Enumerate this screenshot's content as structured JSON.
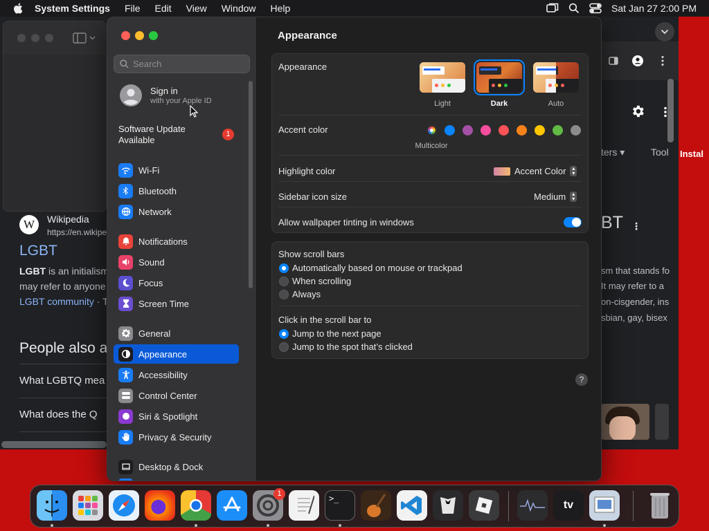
{
  "menubar": {
    "app_name": "System Settings",
    "menus": [
      "File",
      "Edit",
      "View",
      "Window",
      "Help"
    ],
    "clock": "Sat Jan 27  2:00 PM"
  },
  "background": {
    "wiki_name": "Wikipedia",
    "wiki_url": "https://en.wikipe",
    "heading": "LGBT",
    "snippet_bold": "LGBT",
    "snippet_rest": " is an initialism",
    "snippet_line2": "may refer to anyone",
    "snippet_link": "LGBT community",
    "snippet_link_tail": " · T",
    "people_also": "People also a",
    "q1": "What LGBTQ mea",
    "q2": "What does the Q",
    "right_filters": "ters",
    "right_tools": "Tool",
    "right_heading": "BT",
    "right_line1": "sm that stands fo",
    "right_line2": "It may refer to a",
    "right_line3": "on-cisgender, ins",
    "right_line4": "sbian, gay, bisex",
    "right_install": "Instal"
  },
  "sidebar": {
    "search_placeholder": "Search",
    "account_title": "Sign in",
    "account_subtitle": "with your Apple ID",
    "update_title": "Software Update",
    "update_title2": "Available",
    "update_badge": "1",
    "items": [
      {
        "label": "Wi-Fi",
        "icon": "wifi-icon",
        "color": "#1a7cf5"
      },
      {
        "label": "Bluetooth",
        "icon": "bluetooth-icon",
        "color": "#1a7cf5"
      },
      {
        "label": "Network",
        "icon": "globe-icon",
        "color": "#1a7cf5"
      },
      {
        "label": "Notifications",
        "icon": "bell-icon",
        "color": "#e8433a"
      },
      {
        "label": "Sound",
        "icon": "speaker-icon",
        "color": "#e8436a"
      },
      {
        "label": "Focus",
        "icon": "moon-icon",
        "color": "#5b4fd0"
      },
      {
        "label": "Screen Time",
        "icon": "hourglass-icon",
        "color": "#6b4fd0"
      },
      {
        "label": "General",
        "icon": "gear-icon",
        "color": "#8a8a8e"
      },
      {
        "label": "Appearance",
        "icon": "appearance-icon",
        "color": "#1c1c1e"
      },
      {
        "label": "Accessibility",
        "icon": "accessibility-icon",
        "color": "#1a7cf5"
      },
      {
        "label": "Control Center",
        "icon": "toggles-icon",
        "color": "#8a8a8e"
      },
      {
        "label": "Siri & Spotlight",
        "icon": "siri-icon",
        "color": "#8a3ad0"
      },
      {
        "label": "Privacy & Security",
        "icon": "hand-icon",
        "color": "#1a7cf5"
      },
      {
        "label": "Desktop & Dock",
        "icon": "dock-icon",
        "color": "#1c1c1e"
      }
    ]
  },
  "content": {
    "title": "Appearance",
    "appearance_label": "Appearance",
    "appearance_options": [
      "Light",
      "Dark",
      "Auto"
    ],
    "appearance_selected": "Dark",
    "accent_label": "Accent color",
    "accent_selected_name": "Multicolor",
    "accent_colors": [
      "#0a84ff",
      "#a550a7",
      "#f74f9e",
      "#ff5257",
      "#f7821b",
      "#ffc600",
      "#62ba46",
      "#8c8c8c"
    ],
    "highlight_label": "Highlight color",
    "highlight_value": "Accent Color",
    "icon_size_label": "Sidebar icon size",
    "icon_size_value": "Medium",
    "tinting_label": "Allow wallpaper tinting in windows",
    "tinting_on": true,
    "scrollbars_label": "Show scroll bars",
    "scrollbar_options": [
      "Automatically based on mouse or trackpad",
      "When scrolling",
      "Always"
    ],
    "click_label": "Click in the scroll bar to",
    "click_options": [
      "Jump to the next page",
      "Jump to the spot that’s clicked"
    ],
    "help": "?"
  },
  "dock": {
    "apps": [
      "Finder",
      "Launchpad",
      "Safari",
      "Firefox",
      "Chrome",
      "App Store",
      "System Settings",
      "TextEdit",
      "Terminal",
      "GarageBand",
      "VS Code",
      "Bartender",
      "Roblox",
      "Activity Monitor",
      "Apple TV",
      "Preview",
      "Trash"
    ],
    "settings_badge": "1"
  }
}
